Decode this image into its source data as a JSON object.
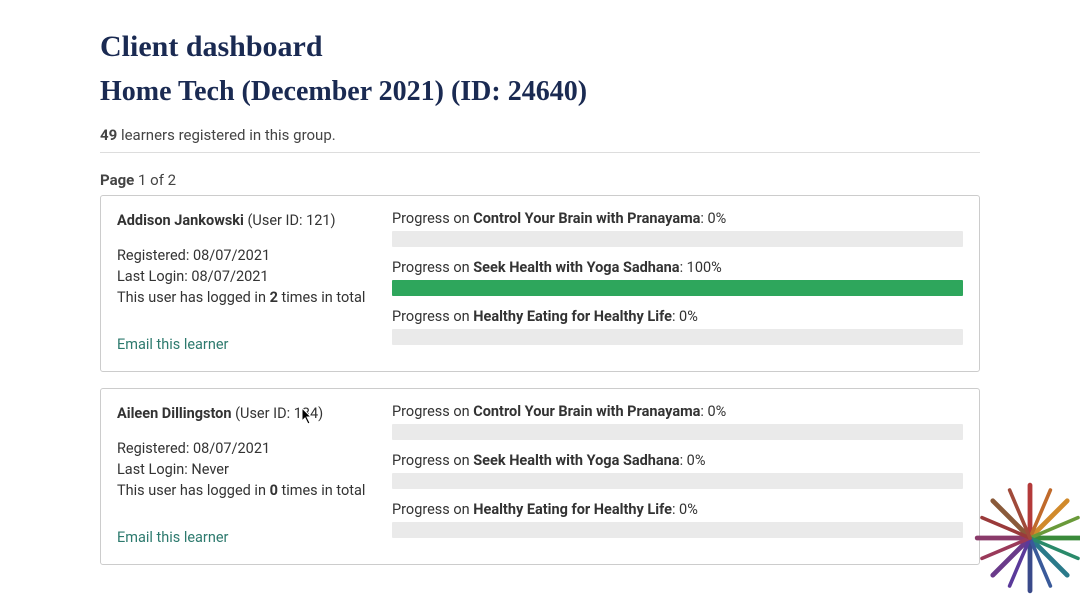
{
  "header": {
    "page_title": "Client dashboard",
    "group_title": "Home Tech (December 2021) (ID: 24640)"
  },
  "summary": {
    "learner_count": "49",
    "registered_text": " learners registered in this group."
  },
  "pager": {
    "prefix": "Page ",
    "current": "1",
    "of_text": " of ",
    "total": "2"
  },
  "labels": {
    "user_id_prefix": " (User ID: ",
    "user_id_suffix": ")",
    "registered_prefix": "Registered: ",
    "last_login_prefix": "Last Login: ",
    "login_count_prefix": "This user has logged in ",
    "login_count_suffix": " times in total",
    "email_link": "Email this learner",
    "progress_prefix": "Progress on ",
    "progress_sep": ": "
  },
  "learners": [
    {
      "name": "Addison Jankowski",
      "user_id": "121",
      "registered": "08/07/2021",
      "last_login": "08/07/2021",
      "login_count": "2",
      "progress": [
        {
          "course": "Control Your Brain with Pranayama",
          "percent": "0%",
          "fill": 0
        },
        {
          "course": "Seek Health with Yoga Sadhana",
          "percent": "100%",
          "fill": 100
        },
        {
          "course": "Healthy Eating for Healthy Life",
          "percent": "0%",
          "fill": 0
        }
      ]
    },
    {
      "name": "Aileen Dillingston",
      "user_id": "134",
      "registered": "08/07/2021",
      "last_login": "Never",
      "login_count": "0",
      "progress": [
        {
          "course": "Control Your Brain with Pranayama",
          "percent": "0%",
          "fill": 0
        },
        {
          "course": "Seek Health with Yoga Sadhana",
          "percent": "0%",
          "fill": 0
        },
        {
          "course": "Healthy Eating for Healthy Life",
          "percent": "0%",
          "fill": 0
        }
      ]
    }
  ],
  "colors": {
    "heading": "#1a2a52",
    "progress_fill": "#2ea65c",
    "link": "#2d7a6e"
  }
}
